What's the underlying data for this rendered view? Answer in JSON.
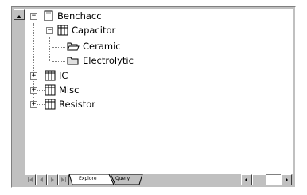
{
  "tree": {
    "root": {
      "label": "Benchacc",
      "expander": "−"
    },
    "capacitor": {
      "label": "Capacitor",
      "expander": "−"
    },
    "ceramic": {
      "label": "Ceramic"
    },
    "electrolytic": {
      "label": "Electrolytic"
    },
    "ic": {
      "label": "IC",
      "expander": "+"
    },
    "misc": {
      "label": "Misc",
      "expander": "+"
    },
    "resistor": {
      "label": "Resistor",
      "expander": "+"
    }
  },
  "tabs": [
    {
      "label": "Explore",
      "active": true
    },
    {
      "label": "Query",
      "active": false
    }
  ],
  "colors": {
    "chrome": "#c0c0c0",
    "shadow": "#808080",
    "highlight": "#ffffff"
  }
}
